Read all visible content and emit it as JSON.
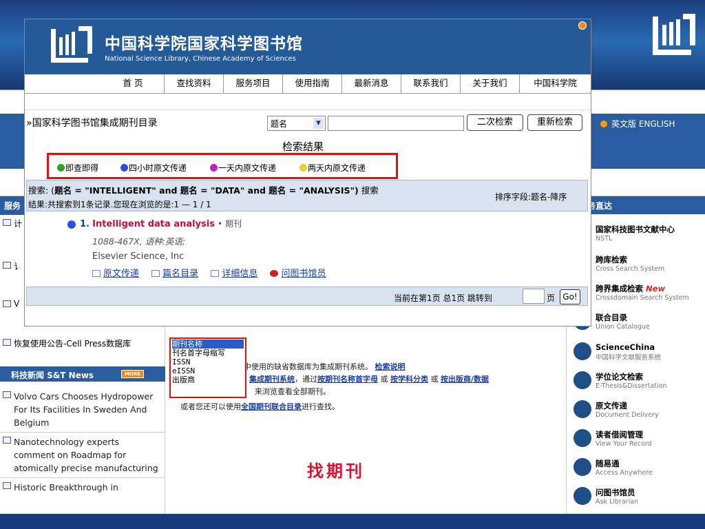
{
  "slide": {
    "footer_title": "找期刊"
  },
  "window": {
    "title": "中国科学院国家科学图书馆",
    "subtitle": "National Science Library, Chinese Academy of Sciences",
    "nav": [
      "首 页",
      "查找资料",
      "服务项目",
      "使用指南",
      "最新消息",
      "联系我们",
      "关于我们",
      "中国科学院"
    ],
    "breadcrumb": "»国家科学图书馆集成期刊目录",
    "search": {
      "field_value": "题名",
      "input_value": "",
      "secondary_search": "二次检索",
      "new_search": "重新检索"
    },
    "results_title": "检索结果",
    "legend": [
      {
        "label": "即查即得",
        "color": "#2fa02f"
      },
      {
        "label": "四小时原文传递",
        "color": "#2b4fd8"
      },
      {
        "label": "一天内原文传递",
        "color": "#c020c0"
      },
      {
        "label": "两天内原文传递",
        "color": "#e8d030"
      }
    ],
    "query": {
      "prefix": "搜索: (",
      "text": "题名 = \"INTELLIGENT\" and 题名 = \"DATA\" and 题名 = \"ANALYSIS\")",
      "suffix": "搜索",
      "result": "结果:共搜索到1条记录.您现在浏览的是:1 — 1 / 1",
      "sort": "排序字段:题名-降序"
    },
    "record": {
      "number": "1.",
      "title": "Intelligent data analysis",
      "kind": "• 期刊",
      "issn_lang": "1088-467X, 语种:英语;",
      "publisher": "Elsevier Science, Inc",
      "links": [
        "原文传递",
        "篇名目录",
        "详细信息",
        "问图书馆员"
      ]
    },
    "pager": {
      "info": "当前在第1页  总1页    跳转到",
      "unit": "页",
      "go": "Go!",
      "page_value": ""
    }
  },
  "background": {
    "english_link": "英文版 ENGLISH",
    "left_head": "服务",
    "left_items": [
      "计",
      "讠",
      "讠",
      "V",
      "恢复使用公告-Cell Press数据库"
    ],
    "news_head": "科技新闻  S&T News",
    "news_more": "MORE",
    "news_items": [
      "Volvo Cars Chooses Hydropower For Its Facilities In Sweden And Belgium",
      "Nanotechnology experts comment on Roadmap for atomically precise manufacturing",
      "Historic Breakthrough in"
    ],
    "right_head": "务直达",
    "right_items": [
      {
        "title": "国家科技图书文献中心",
        "sub": "NSTL",
        "icon": "nstl-icon"
      },
      {
        "title": "跨库检索",
        "sub": "Cross Search System",
        "icon": "cross-search-icon"
      },
      {
        "title": "跨界集成检索",
        "sub": "Crossdomain Search System",
        "icon": "crossdomain-icon",
        "badge": "New"
      },
      {
        "title": "联合目录",
        "sub": "Union Catalogue",
        "icon": "union-catalogue-icon"
      },
      {
        "title": "ScienceChina",
        "sub": "中国科学文献服务系统",
        "icon": "sciencechina-icon"
      },
      {
        "title": "学位论文检索",
        "sub": "E-Thesis&Dissertation",
        "icon": "thesis-icon"
      },
      {
        "title": "原文传递",
        "sub": "Document Delivery",
        "icon": "document-delivery-icon"
      },
      {
        "title": "读者借阅管理",
        "sub": "View Your Record",
        "icon": "reader-record-icon"
      },
      {
        "title": "随易通",
        "sub": "Access Anywhere",
        "icon": "access-anywhere-icon"
      },
      {
        "title": "问图书馆员",
        "sub": "Ask Librarian",
        "icon": "ask-librarian-icon"
      }
    ],
    "dropdown_options": [
      "期刊名称",
      "刊名首字母缩写",
      "ISSN",
      "eISSN",
      "出版商"
    ],
    "center_lines": {
      "line1_text": "中使用的缺省数据库为集成期刊系统。",
      "line1_link": "检索说明",
      "line2_link1": "集成期刊系统",
      "line2_mid": "，通过",
      "line2_link2": "按期刊名称首字母",
      "line2_or1": " 或 ",
      "line2_link3": "按学科分类",
      "line2_or2": " 或 ",
      "line2_link4": "按出版商/数据",
      "line3_text": "来浏览查看全部期刊。",
      "line4_pre": "或者您还可以使用",
      "line4_link": "全国期刊联合目录",
      "line4_post": "进行查找。"
    }
  }
}
